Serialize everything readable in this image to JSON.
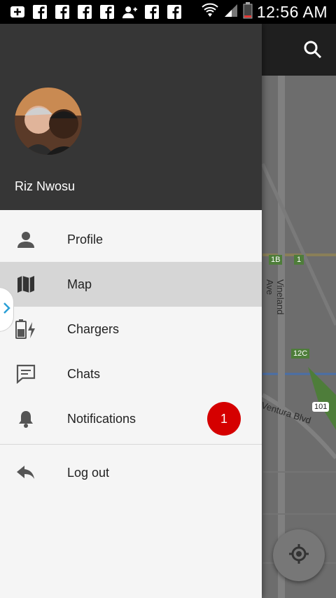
{
  "status_bar": {
    "time": "12:56 AM",
    "icons": [
      "add-box-icon",
      "facebook-icon",
      "facebook-icon",
      "facebook-icon",
      "facebook-icon",
      "add-person-icon",
      "facebook-icon",
      "facebook-icon"
    ],
    "right_icons": [
      "wifi-icon",
      "signal-icon",
      "battery-icon"
    ]
  },
  "user": {
    "name": "Riz Nwosu"
  },
  "menu": {
    "items": [
      {
        "label": "Profile",
        "icon": "person-icon"
      },
      {
        "label": "Map",
        "icon": "map-icon"
      },
      {
        "label": "Chargers",
        "icon": "battery-charging-icon"
      },
      {
        "label": "Chats",
        "icon": "chat-icon"
      },
      {
        "label": "Notifications",
        "icon": "bell-icon"
      }
    ],
    "notifications_badge": "1",
    "logout": {
      "label": "Log out",
      "icon": "reply-icon"
    }
  },
  "map": {
    "labels": [
      "Vineland Ave",
      "Ventura Blvd",
      "1B",
      "1",
      "12C",
      "101"
    ]
  },
  "colors": {
    "header_bg": "#363636",
    "drawer_bg": "#f5f5f5",
    "selected_bg": "#d6d6d6",
    "badge": "#d50000",
    "map_road_green": "#4e7d3a"
  }
}
